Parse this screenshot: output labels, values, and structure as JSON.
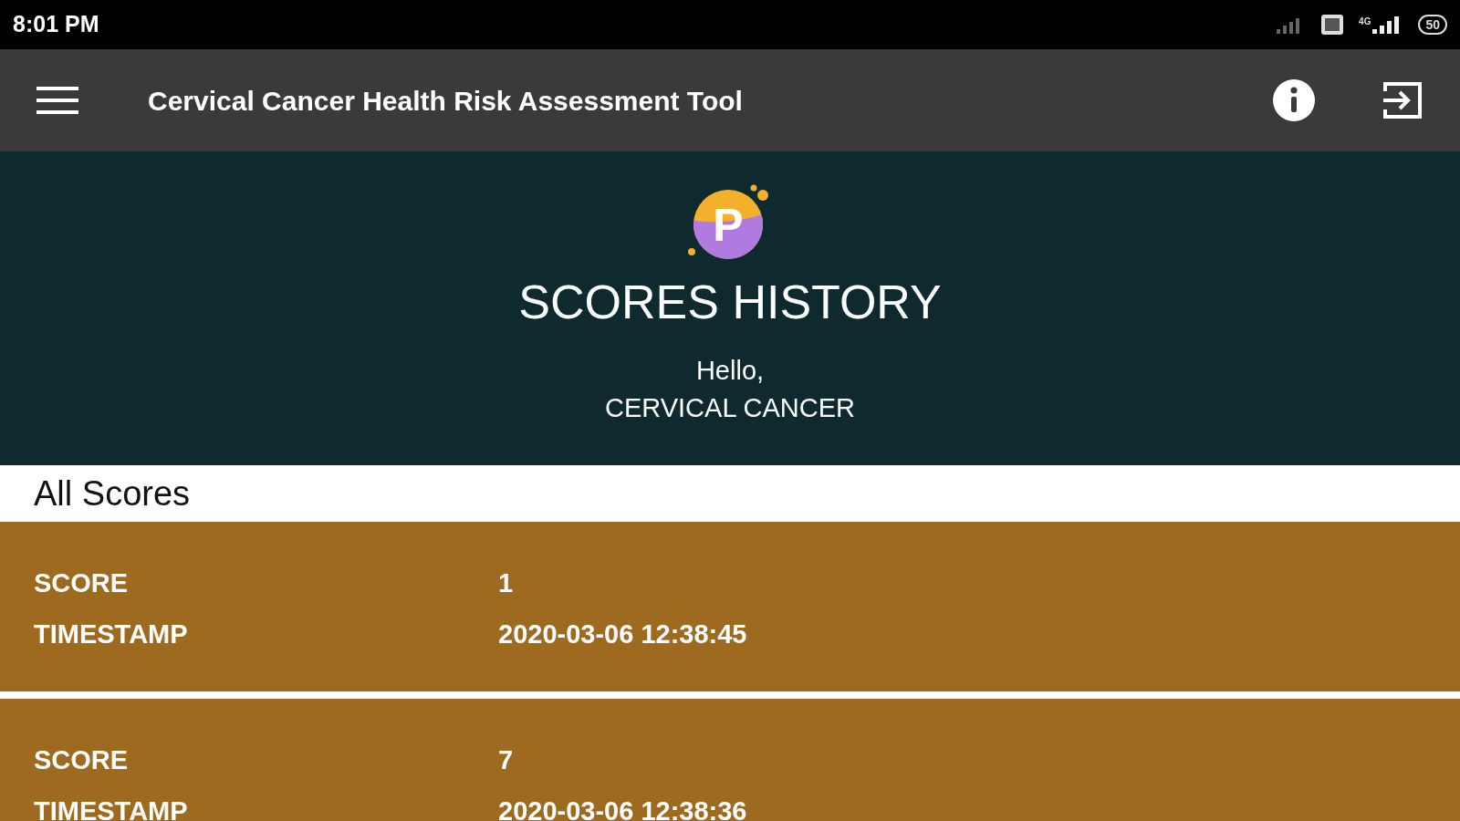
{
  "status_bar": {
    "time": "8:01 PM",
    "network": "4G",
    "battery": "50"
  },
  "toolbar": {
    "title": "Cervical Cancer Health Risk Assessment Tool"
  },
  "header": {
    "logo_letter": "P",
    "title": "SCORES HISTORY",
    "greeting": "Hello,",
    "user": "CERVICAL CANCER"
  },
  "section": {
    "title": "All Scores"
  },
  "scores": [
    {
      "score_label": "SCORE",
      "score": "1",
      "timestamp_label": "TIMESTAMP",
      "timestamp": "2020-03-06 12:38:45"
    },
    {
      "score_label": "SCORE",
      "score": "7",
      "timestamp_label": "TIMESTAMP",
      "timestamp": "2020-03-06 12:38:36"
    }
  ]
}
